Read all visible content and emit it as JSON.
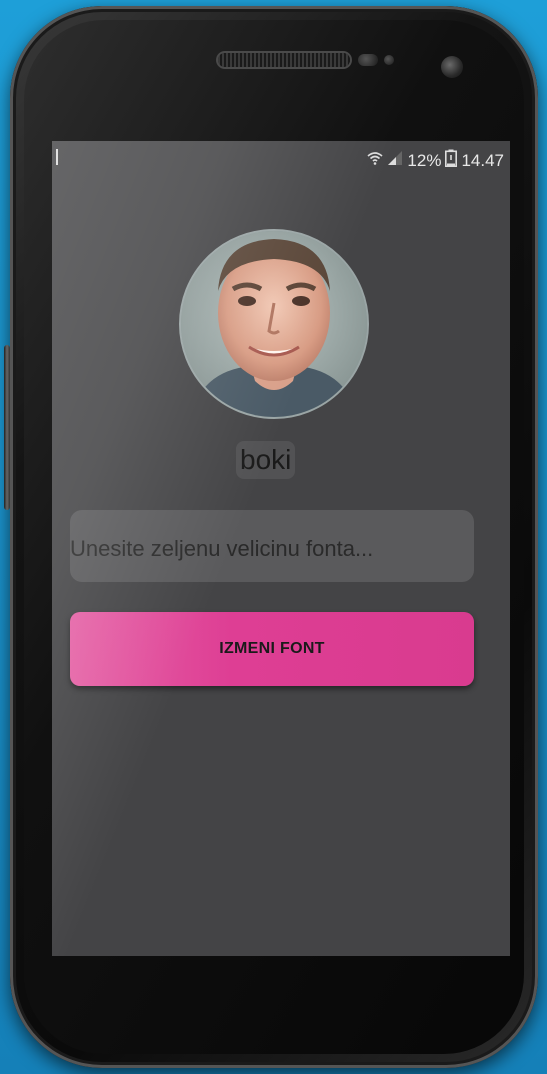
{
  "status_bar": {
    "battery_percent": "12%",
    "time": "14.47",
    "icons": [
      "wifi-icon",
      "signal-icon",
      "battery-icon"
    ]
  },
  "profile": {
    "username": "boki"
  },
  "font_form": {
    "input_placeholder": "Unesite zeljenu velicinu fonta...",
    "input_value": "",
    "submit_label": "IZMENI FONT"
  },
  "colors": {
    "accent": "#de3e94",
    "screen_bg": "#444446",
    "page_bg": "#1e9fd8"
  }
}
